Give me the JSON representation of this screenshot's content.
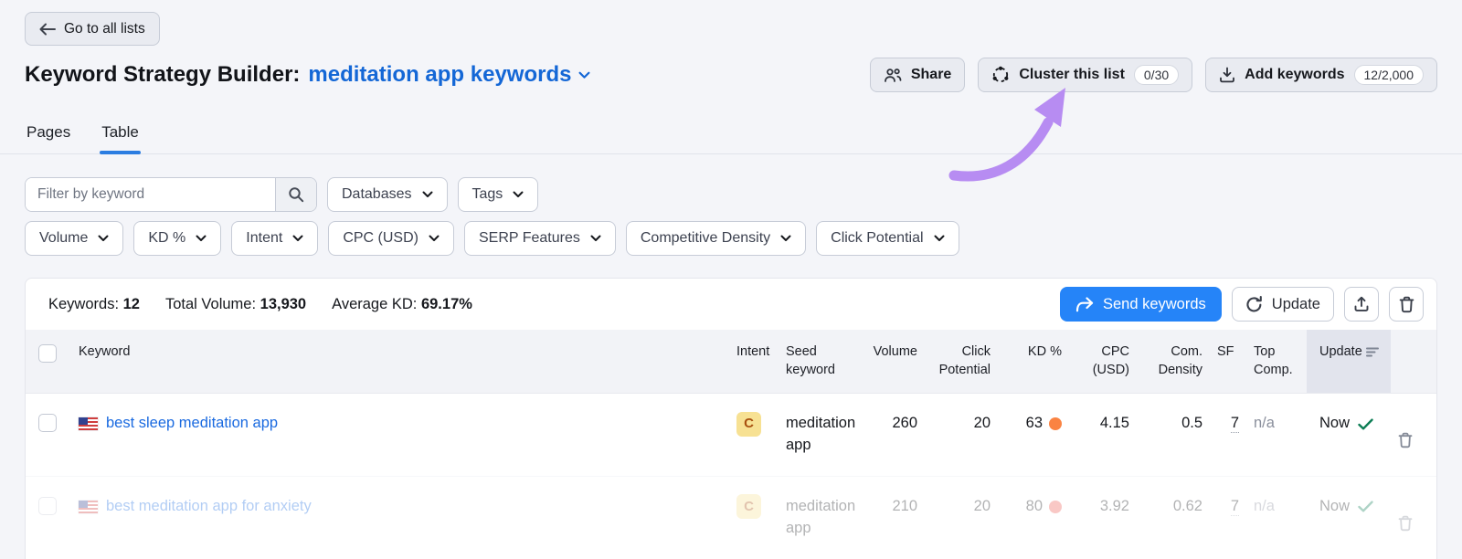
{
  "page": {
    "back_button": "Go to all lists",
    "title": "Keyword Strategy Builder:",
    "list_name": "meditation app keywords"
  },
  "header_actions": {
    "share": "Share",
    "cluster": "Cluster this list",
    "cluster_count": "0/30",
    "add_keywords": "Add keywords",
    "add_count": "12/2,000"
  },
  "tabs": {
    "pages": "Pages",
    "table": "Table"
  },
  "filters": {
    "keyword_placeholder": "Filter by keyword",
    "databases": "Databases",
    "tags": "Tags",
    "row2": [
      "Volume",
      "KD %",
      "Intent",
      "CPC (USD)",
      "SERP Features",
      "Competitive Density",
      "Click Potential"
    ]
  },
  "stats": {
    "keywords_label": "Keywords:",
    "keywords_value": "12",
    "volume_label": "Total Volume:",
    "volume_value": "13,930",
    "kd_label": "Average KD:",
    "kd_value": "69.17%"
  },
  "toolbar": {
    "send_label": "Send keywords",
    "update_label": "Update"
  },
  "table": {
    "headers": [
      "Keyword",
      "Intent",
      "Seed keyword",
      "Volume",
      "Click Potential",
      "KD %",
      "CPC (USD)",
      "Com. Density",
      "SF",
      "Top Comp.",
      "Update"
    ],
    "rows": [
      {
        "keyword": "best sleep meditation app",
        "intent": "C",
        "seed": "meditation app",
        "volume": "260",
        "click_potential": "20",
        "kd": "63",
        "kd_color": "#fa8342",
        "cpc": "4.15",
        "com_density": "0.5",
        "sf": "7",
        "top_comp": "n/a",
        "updated": "Now"
      },
      {
        "keyword": "best meditation app for anxiety",
        "intent": "C",
        "seed": "meditation app",
        "volume": "210",
        "click_potential": "20",
        "kd": "80",
        "kd_color": "#ee5a51",
        "cpc": "3.92",
        "com_density": "0.62",
        "sf": "7",
        "top_comp": "n/a",
        "updated": "Now"
      }
    ]
  },
  "colors": {
    "accent_blue": "#1467d6",
    "primary_button": "#2584f8",
    "active_tab_underline": "#2b7de1",
    "intent_badge_bg": "#f7e193",
    "intent_badge_text": "#a8500f",
    "check_green": "#0c7d54",
    "annotation_arrow": "#b78cf2"
  }
}
